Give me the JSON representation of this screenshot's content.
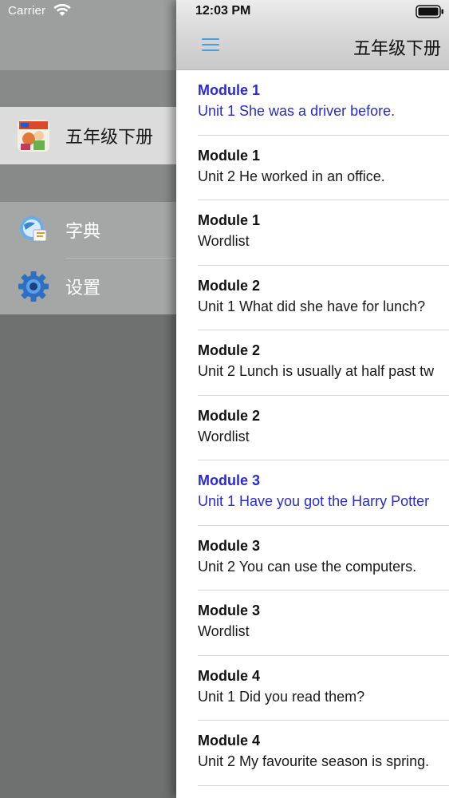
{
  "status": {
    "carrier": "Carrier",
    "time": "12:03 PM"
  },
  "sidebar": {
    "book_item": {
      "label": "五年级下册",
      "icon": "book-cover-icon"
    },
    "menu_items": [
      {
        "label": "字典",
        "icon": "dictionary-icon"
      },
      {
        "label": "设置",
        "icon": "gear-icon"
      }
    ]
  },
  "navbar": {
    "title": "五年级下册",
    "menu_icon": "hamburger-menu-icon",
    "accent_color": "#4a9be0"
  },
  "list": {
    "highlight_color": "#2a2ad0",
    "rows": [
      {
        "module": "Module 1",
        "unit": "Unit 1 She was a driver before.",
        "highlighted": true
      },
      {
        "module": "Module 1",
        "unit": "Unit 2 He worked in an office.",
        "highlighted": false
      },
      {
        "module": "Module 1",
        "unit": "Wordlist",
        "highlighted": false
      },
      {
        "module": "Module 2",
        "unit": "Unit 1 What did she have for lunch?",
        "highlighted": false
      },
      {
        "module": "Module 2",
        "unit": "Unit 2 Lunch is usually at half past tw",
        "highlighted": false
      },
      {
        "module": "Module 2",
        "unit": "Wordlist",
        "highlighted": false
      },
      {
        "module": "Module 3",
        "unit": "Unit 1 Have you got the Harry Potter",
        "highlighted": true
      },
      {
        "module": "Module 3",
        "unit": "Unit 2 You can use the computers.",
        "highlighted": false
      },
      {
        "module": "Module 3",
        "unit": "Wordlist",
        "highlighted": false
      },
      {
        "module": "Module 4",
        "unit": "Unit 1 Did you read them?",
        "highlighted": false
      },
      {
        "module": "Module 4",
        "unit": "Unit 2 My favourite season is spring.",
        "highlighted": false
      }
    ]
  }
}
